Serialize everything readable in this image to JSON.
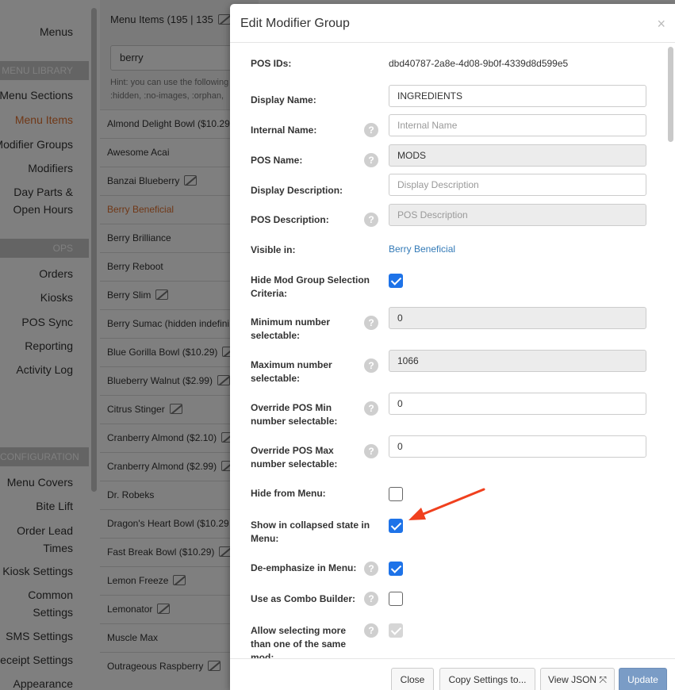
{
  "nav": {
    "menus": "Menus",
    "library_header": "MENU LIBRARY",
    "library": [
      "Menu Sections",
      "Menu Items",
      "Modifier Groups",
      "Modifiers"
    ],
    "day_parts": [
      "Day Parts &",
      "Open Hours"
    ],
    "ops_header": "OPS",
    "ops": [
      "Orders",
      "Kiosks",
      "POS Sync",
      "Reporting",
      "Activity Log"
    ],
    "config_header": "CONFIGURATION",
    "config": {
      "menu_covers": "Menu Covers",
      "bite_lift": "Bite Lift",
      "order_lead": [
        "Order Lead",
        "Times"
      ],
      "kiosk_settings": "Kiosk Settings",
      "common_settings": [
        "Common",
        "Settings"
      ],
      "sms_settings": "SMS Settings",
      "receipt_settings": "eceipt Settings",
      "appearance": "Appearance"
    }
  },
  "items_panel": {
    "title": "Menu Items (195 | 135",
    "search_value": "berry",
    "hint_lines": [
      "Hint: you can use the following",
      ":hidden, :no-images, :orphan,"
    ],
    "items": [
      {
        "label": "Almond Delight Bowl ($10.29",
        "noimg": false
      },
      {
        "label": "Awesome Acai",
        "noimg": false
      },
      {
        "label": "Banzai Blueberry",
        "noimg": true
      },
      {
        "label": "Berry Beneficial",
        "noimg": false,
        "active": true
      },
      {
        "label": "Berry Brilliance",
        "noimg": false
      },
      {
        "label": "Berry Reboot",
        "noimg": false
      },
      {
        "label": "Berry Slim",
        "noimg": true
      },
      {
        "label": "Berry Sumac (hidden indefini",
        "noimg": false
      },
      {
        "label": "Blue Gorilla Bowl ($10.29)",
        "noimg": true
      },
      {
        "label": "Blueberry Walnut ($2.99)",
        "noimg": true
      },
      {
        "label": "Citrus Stinger",
        "noimg": true
      },
      {
        "label": "Cranberry Almond ($2.10)",
        "noimg": true
      },
      {
        "label": "Cranberry Almond ($2.99)",
        "noimg": true
      },
      {
        "label": "Dr. Robeks",
        "noimg": false
      },
      {
        "label": "Dragon's Heart Bowl ($10.29",
        "noimg": false
      },
      {
        "label": "Fast Break Bowl ($10.29)",
        "noimg": true
      },
      {
        "label": "Lemon Freeze",
        "noimg": true
      },
      {
        "label": "Lemonator",
        "noimg": true
      },
      {
        "label": "Muscle Max",
        "noimg": false
      },
      {
        "label": "Outrageous Raspberry",
        "noimg": true
      }
    ]
  },
  "modal": {
    "title": "Edit Modifier Group",
    "close": "×",
    "pos_ids_label": "POS IDs:",
    "pos_ids_value": "dbd40787-2a8e-4d08-9b0f-4339d8d599e5",
    "display_name_label": "Display Name:",
    "display_name_value": "INGREDIENTS",
    "internal_name_label": "Internal Name:",
    "internal_name_placeholder": "Internal Name",
    "pos_name_label": "POS Name:",
    "pos_name_value": "MODS",
    "display_desc_label": "Display Description:",
    "display_desc_placeholder": "Display Description",
    "pos_desc_label": "POS Description:",
    "pos_desc_placeholder": "POS Description",
    "visible_in_label": "Visible in:",
    "visible_in_value": "Berry Beneficial",
    "hide_criteria_label": [
      "Hide Mod Group Selection",
      "Criteria:"
    ],
    "min_label": [
      "Minimum number",
      "selectable:"
    ],
    "min_value": "0",
    "max_label": [
      "Maximum number",
      "selectable:"
    ],
    "max_value": "1066",
    "ovr_min_label": [
      "Override POS Min",
      "number selectable:"
    ],
    "ovr_min_value": "0",
    "ovr_max_label": [
      "Override POS Max",
      "number selectable:"
    ],
    "ovr_max_value": "0",
    "hide_menu_label": "Hide from Menu:",
    "collapsed_label": [
      "Show in collapsed state in",
      "Menu:"
    ],
    "deemph_label": "De-emphasize in Menu:",
    "combo_label": "Use as Combo Builder:",
    "allow_more_label": [
      "Allow selecting more",
      "than one of the same",
      "mod:"
    ],
    "help_glyph": "?",
    "buttons": {
      "close": "Close",
      "copy": "Copy Settings to...",
      "json": "View JSON ⤧",
      "update": "Update"
    }
  },
  "colors": {
    "accent_orange": "#e0702f",
    "checkbox_blue": "#1e73e8",
    "arrow_red": "#f0401e",
    "link_blue": "#337ab7"
  }
}
